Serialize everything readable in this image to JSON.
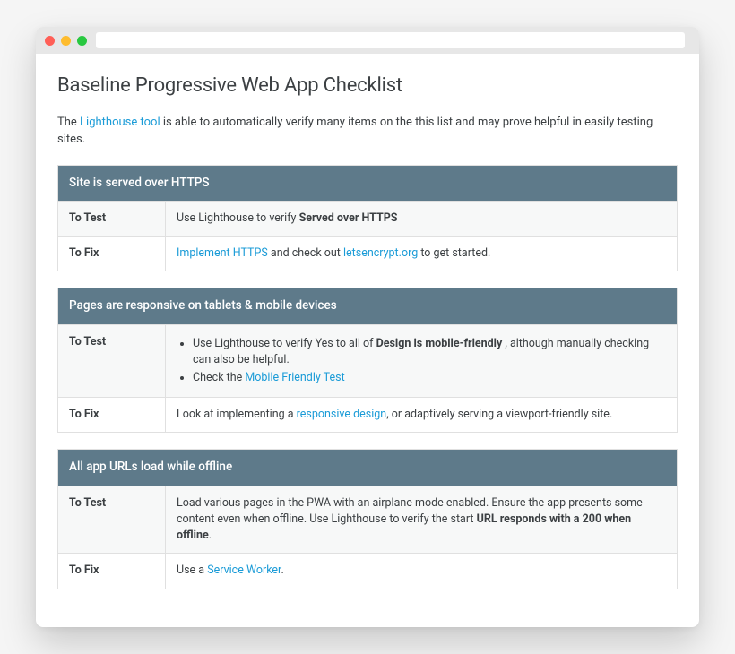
{
  "window": {
    "traffic": [
      "red",
      "yellow",
      "green"
    ]
  },
  "page": {
    "title": "Baseline Progressive Web App Checklist",
    "intro": {
      "pre": "The ",
      "link": "Lighthouse tool",
      "post": " is able to automatically verify many items on the this list and may prove helpful in easily testing sites."
    }
  },
  "section1": {
    "header": "Site is served over HTTPS",
    "test_label": "To Test",
    "test_pre": "Use Lighthouse to verify ",
    "test_bold": "Served over HTTPS",
    "fix_label": "To Fix",
    "fix_link1": "Implement HTTPS",
    "fix_mid": " and check out ",
    "fix_link2": "letsencrypt.org",
    "fix_post": " to get started."
  },
  "section2": {
    "header": "Pages are responsive on tablets & mobile devices",
    "test_label": "To Test",
    "li1_pre": "Use Lighthouse to verify Yes to all of ",
    "li1_bold": "Design is mobile-friendly",
    "li1_post": " , although manually checking can also be helpful.",
    "li2_pre": "Check the ",
    "li2_link": "Mobile Friendly Test",
    "fix_label": "To Fix",
    "fix_pre": "Look at implementing a ",
    "fix_link": "responsive design",
    "fix_post": ", or adaptively serving a viewport-friendly site."
  },
  "section3": {
    "header": "All app URLs load while offline",
    "test_label": "To Test",
    "test_pre": "Load various pages in the PWA with an airplane mode enabled. Ensure the app presents some content even when offline. Use Lighthouse to verify the start ",
    "test_bold": "URL responds with a 200 when offline",
    "test_post": ".",
    "fix_label": "To Fix",
    "fix_pre": "Use a ",
    "fix_link": "Service Worker",
    "fix_post": "."
  }
}
